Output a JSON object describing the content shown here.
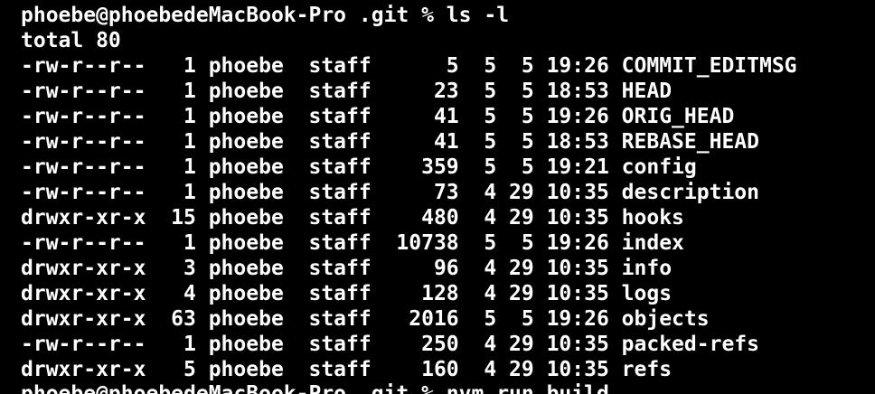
{
  "terminal": {
    "prompt_top": "phoebe@phoebedeMacBook-Pro .git % ls -l",
    "total": "total 80",
    "entries": [
      "-rw-r--r--   1 phoebe  staff      5  5  5 19:26 COMMIT_EDITMSG",
      "-rw-r--r--   1 phoebe  staff     23  5  5 18:53 HEAD",
      "-rw-r--r--   1 phoebe  staff     41  5  5 19:26 ORIG_HEAD",
      "-rw-r--r--   1 phoebe  staff     41  5  5 18:53 REBASE_HEAD",
      "-rw-r--r--   1 phoebe  staff    359  5  5 19:21 config",
      "-rw-r--r--   1 phoebe  staff     73  4 29 10:35 description",
      "drwxr-xr-x  15 phoebe  staff    480  4 29 10:35 hooks",
      "-rw-r--r--   1 phoebe  staff  10738  5  5 19:26 index",
      "drwxr-xr-x   3 phoebe  staff     96  4 29 10:35 info",
      "drwxr-xr-x   4 phoebe  staff    128  4 29 10:35 logs",
      "drwxr-xr-x  63 phoebe  staff   2016  5  5 19:26 objects",
      "-rw-r--r--   1 phoebe  staff    250  4 29 10:35 packed-refs",
      "drwxr-xr-x   5 phoebe  staff    160  4 29 10:35 refs"
    ],
    "prompt_bottom": "phoebe@phoebedeMacBook-Pro .git % nvm run build"
  },
  "colors": {
    "background": "#000000",
    "foreground": "#ffffff"
  }
}
